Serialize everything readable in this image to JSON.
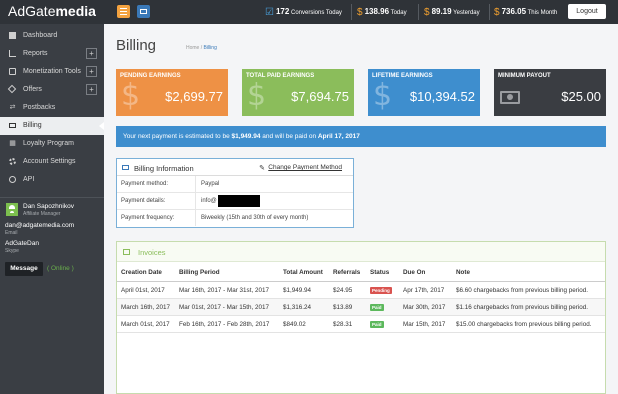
{
  "header": {
    "logo_part1": "AdGate",
    "logo_part2": "media",
    "conversions_value": "172",
    "conversions_label": "Conversions Today",
    "today_value": "138.96",
    "today_label": "Today",
    "yesterday_value": "89.19",
    "yesterday_label": "Yesterday",
    "month_value": "736.05",
    "month_label": "This Month",
    "logout_label": "Logout"
  },
  "sidebar": {
    "items": [
      {
        "label": "Dashboard",
        "icon": "dashboard-icon"
      },
      {
        "label": "Reports",
        "icon": "reports-icon",
        "expandable": true
      },
      {
        "label": "Monetization Tools",
        "icon": "lock-icon",
        "expandable": true
      },
      {
        "label": "Offers",
        "icon": "tag-icon",
        "expandable": true
      },
      {
        "label": "Postbacks",
        "icon": "postback-icon"
      },
      {
        "label": "Billing",
        "icon": "credit-card-icon",
        "active": true
      },
      {
        "label": "Loyalty Program",
        "icon": "loyalty-icon"
      },
      {
        "label": "Account Settings",
        "icon": "gear-icon"
      },
      {
        "label": "API",
        "icon": "api-icon"
      }
    ],
    "manager": {
      "name": "Dan Sapozhnikov",
      "role": "Affiliate Manager",
      "email": "dan@adgatemedia.com",
      "email_label": "Email",
      "skype": "AdGateDan",
      "skype_label": "Skype",
      "message_label": "Message",
      "status": "( Online )"
    }
  },
  "page": {
    "title": "Billing",
    "breadcrumb_home": "Home",
    "breadcrumb_sep": "/",
    "breadcrumb_current": "Billing"
  },
  "cards": [
    {
      "title": "PENDING EARNINGS",
      "value": "$2,699.77",
      "color": "#ee9145"
    },
    {
      "title": "TOTAL PAID EARNINGS",
      "value": "$7,694.75",
      "color": "#8bbd5b"
    },
    {
      "title": "LIFETIME EARNINGS",
      "value": "$10,394.52",
      "color": "#3e8ece"
    },
    {
      "title": "MINIMUM PAYOUT",
      "value": "$25.00",
      "color": "#3a3d42"
    }
  ],
  "notice": {
    "prefix": "Your next payment is estimated to be ",
    "amount": "$1,949.94",
    "middle": " and will be paid on ",
    "date": "April 17, 2017"
  },
  "billing_info": {
    "title": "Billing Information",
    "change_label": "Change Payment Method",
    "rows": [
      {
        "key": "Payment method:",
        "value": "Paypal"
      },
      {
        "key": "Payment details:",
        "value": "info@"
      },
      {
        "key": "Payment frequency:",
        "value": "Biweekly (15th and 30th of every month)"
      }
    ]
  },
  "invoices": {
    "title": "Invoices",
    "columns": [
      "Creation Date",
      "Billing Period",
      "Total Amount",
      "Referrals",
      "Status",
      "Due On",
      "Note"
    ],
    "rows": [
      {
        "date": "April 01st, 2017",
        "period": "Mar 16th, 2017 - Mar 31st, 2017",
        "total": "$1,949.94",
        "referrals": "$24.95",
        "status": "Pending",
        "due": "Apr 17th, 2017",
        "note": "$6.60 chargebacks from previous billing period."
      },
      {
        "date": "March 16th, 2017",
        "period": "Mar 01st, 2017 - Mar 15th, 2017",
        "total": "$1,316.24",
        "referrals": "$13.89",
        "status": "Paid",
        "due": "Mar 30th, 2017",
        "note": "$1.16 chargebacks from previous billing period."
      },
      {
        "date": "March 01st, 2017",
        "period": "Feb 16th, 2017 - Feb 28th, 2017",
        "total": "$849.02",
        "referrals": "$28.31",
        "status": "Paid",
        "due": "Mar 15th, 2017",
        "note": "$15.00 chargebacks from previous billing period."
      }
    ]
  }
}
